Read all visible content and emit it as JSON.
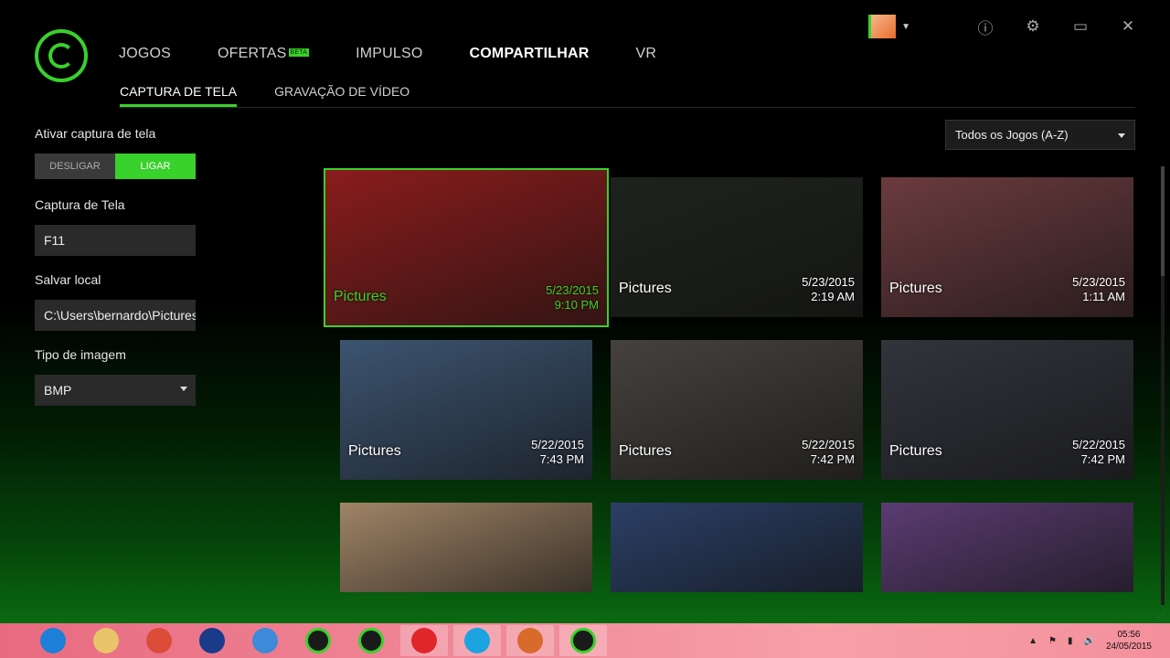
{
  "nav": {
    "items": [
      {
        "label": "JOGOS",
        "active": false
      },
      {
        "label": "OFERTAS",
        "active": false,
        "badge": "BETA"
      },
      {
        "label": "IMPULSO",
        "active": false
      },
      {
        "label": "COMPARTILHAR",
        "active": true
      },
      {
        "label": "VR",
        "active": false
      }
    ],
    "subitems": [
      {
        "label": "CAPTURA DE TELA",
        "active": true
      },
      {
        "label": "GRAVAÇÃO DE VÍDEO",
        "active": false
      }
    ]
  },
  "settings": {
    "enable_label": "Ativar captura de tela",
    "toggle_off": "DESLIGAR",
    "toggle_on": "LIGAR",
    "hotkey_label": "Captura de Tela",
    "hotkey_value": "F11",
    "path_label": "Salvar local",
    "path_value": "C:\\Users\\bernardo\\Pictures",
    "type_label": "Tipo de imagem",
    "type_value": "BMP"
  },
  "sort": {
    "value": "Todos os Jogos (A-Z)"
  },
  "thumbs": [
    {
      "name": "Pictures",
      "date": "5/23/2015",
      "time": "9:10 PM",
      "selected": true,
      "bg": "#8a1c1c"
    },
    {
      "name": "Pictures",
      "date": "5/23/2015",
      "time": "2:19 AM",
      "selected": false,
      "bg": "#1e221c"
    },
    {
      "name": "Pictures",
      "date": "5/23/2015",
      "time": "1:11 AM",
      "selected": false,
      "bg": "#6b3b3e"
    },
    {
      "name": "Pictures",
      "date": "5/22/2015",
      "time": "7:43 PM",
      "selected": false,
      "bg": "#3c5470"
    },
    {
      "name": "Pictures",
      "date": "5/22/2015",
      "time": "7:42 PM",
      "selected": false,
      "bg": "#45413e"
    },
    {
      "name": "Pictures",
      "date": "5/22/2015",
      "time": "7:42 PM",
      "selected": false,
      "bg": "#32343c"
    },
    {
      "name": "",
      "date": "",
      "time": "",
      "selected": false,
      "bg": "#a08466"
    },
    {
      "name": "",
      "date": "",
      "time": "",
      "selected": false,
      "bg": "#2b3f66"
    },
    {
      "name": "",
      "date": "",
      "time": "",
      "selected": false,
      "bg": "#5b3c72"
    }
  ],
  "taskbar": {
    "apps": [
      "ie-icon",
      "explorer-icon",
      "chrome-icon",
      "pb-icon",
      "cortana-icon",
      "razer-icon",
      "cloud-icon",
      "opera-icon",
      "skype-icon",
      "monkey-icon",
      "razer-synapse-icon"
    ],
    "clock_time": "05:56",
    "clock_date": "24/05/2015"
  },
  "colors": {
    "accent": "#39d12b"
  }
}
